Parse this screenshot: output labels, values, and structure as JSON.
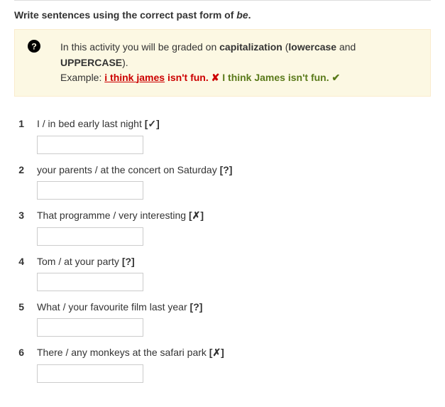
{
  "instruction": {
    "prefix": "Write sentences using the correct past form of ",
    "italic": "be",
    "suffix": "."
  },
  "hint": {
    "line1_prefix": "In this activity you will be graded on ",
    "capitalization": "capitalization",
    "paren_open": " (",
    "lowercase": "lowercase",
    "and": " and ",
    "uppercase": "UPPERCASE",
    "paren_close": ").",
    "example_label": "Example: ",
    "wrong_u1": "i think ",
    "wrong_u2": "james",
    "wrong_plain": " isn't fun. ",
    "cross": "✘",
    "spacer": "  ",
    "right": "I think James isn't fun. ",
    "check": "✔"
  },
  "questions": [
    {
      "num": "1",
      "prompt": "I / in bed early last night ",
      "tag": "[✓]"
    },
    {
      "num": "2",
      "prompt": "your parents / at the concert on Saturday ",
      "tag": "[?]"
    },
    {
      "num": "3",
      "prompt": "That programme / very interesting ",
      "tag": "[✗]"
    },
    {
      "num": "4",
      "prompt": "Tom / at your party ",
      "tag": "[?]"
    },
    {
      "num": "5",
      "prompt": "What / your favourite film last year ",
      "tag": "[?]"
    },
    {
      "num": "6",
      "prompt": "There / any monkeys at the safari park ",
      "tag": "[✗]"
    }
  ]
}
